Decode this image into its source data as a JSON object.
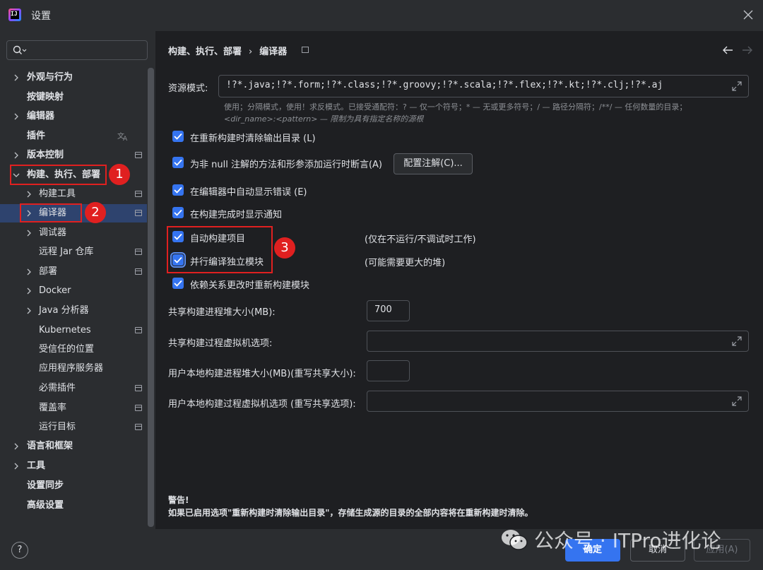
{
  "window": {
    "title": "设置"
  },
  "sidebar": {
    "items": [
      {
        "label": "外观与行为"
      },
      {
        "label": "按键映射"
      },
      {
        "label": "编辑器"
      },
      {
        "label": "插件"
      },
      {
        "label": "版本控制"
      },
      {
        "label": "构建、执行、部署"
      },
      {
        "label": "构建工具"
      },
      {
        "label": "编译器"
      },
      {
        "label": "调试器"
      },
      {
        "label": "远程 Jar 仓库"
      },
      {
        "label": "部署"
      },
      {
        "label": "Docker"
      },
      {
        "label": "Java 分析器"
      },
      {
        "label": "Kubernetes"
      },
      {
        "label": "受信任的位置"
      },
      {
        "label": "应用程序服务器"
      },
      {
        "label": "必需插件"
      },
      {
        "label": "覆盖率"
      },
      {
        "label": "运行目标"
      },
      {
        "label": "语言和框架"
      },
      {
        "label": "工具"
      },
      {
        "label": "设置同步"
      },
      {
        "label": "高级设置"
      }
    ]
  },
  "breadcrumb": {
    "parent": "构建、执行、部署",
    "separator": "›",
    "current": "编译器"
  },
  "resource": {
    "label": "资源模式:",
    "value": "!?*.java;!?*.form;!?*.class;!?*.groovy;!?*.scala;!?*.flex;!?*.kt;!?*.clj;!?*.aj",
    "hint1": "使用；分隔模式，使用！求反模式。已接受通配符：? — 仅一个符号；* — 无或更多符号；/ — 路径分隔符；/**/ — 任何数量的目录；",
    "hint2": "<dir_name>:<pattern> — 限制为具有指定名称的源根"
  },
  "checkboxes": {
    "clear_output": "在重新构建时清除输出目录 (L)",
    "not_null": "为非 null 注解的方法和形参添加运行时断言(A)",
    "auto_show_errors": "在编辑器中自动显示错误 (E)",
    "notify": "在构建完成时显示通知",
    "auto_build": "自动构建项目",
    "parallel": "并行编译独立模块",
    "rebuild_on_dep": "依赖关系更改时重新构建模块"
  },
  "configure_annotations_button": "配置注解(C)...",
  "notes": {
    "auto_build": "(仅在不运行/不调试时工作)",
    "parallel": "(可能需要更大的堆)"
  },
  "fields": {
    "shared_heap_label": "共享构建进程堆大小(MB):",
    "shared_heap_value": "700",
    "shared_vm_label": "共享构建过程虚拟机选项:",
    "user_heap_label": "用户本地构建进程堆大小(MB)(重写共享大小):",
    "user_vm_label": "用户本地构建过程虚拟机选项 (重写共享选项):"
  },
  "warning": {
    "title": "警告!",
    "text": "如果已启用选项\"重新构建时清除输出目录\"，存储生成源的目录的全部内容将在重新构建时清除。"
  },
  "footer": {
    "help": "?",
    "ok": "确定",
    "cancel": "取消",
    "apply": "应用(A)"
  },
  "annotations": {
    "b1": "1",
    "b2": "2",
    "b3": "3"
  },
  "watermark": "公众号 · ITPro进化论",
  "colors": {
    "accent": "#3574f0",
    "selection": "#2e436e",
    "annotation_red": "#e02020",
    "bg_main": "#1e1f22",
    "bg_panel": "#2b2d30"
  }
}
